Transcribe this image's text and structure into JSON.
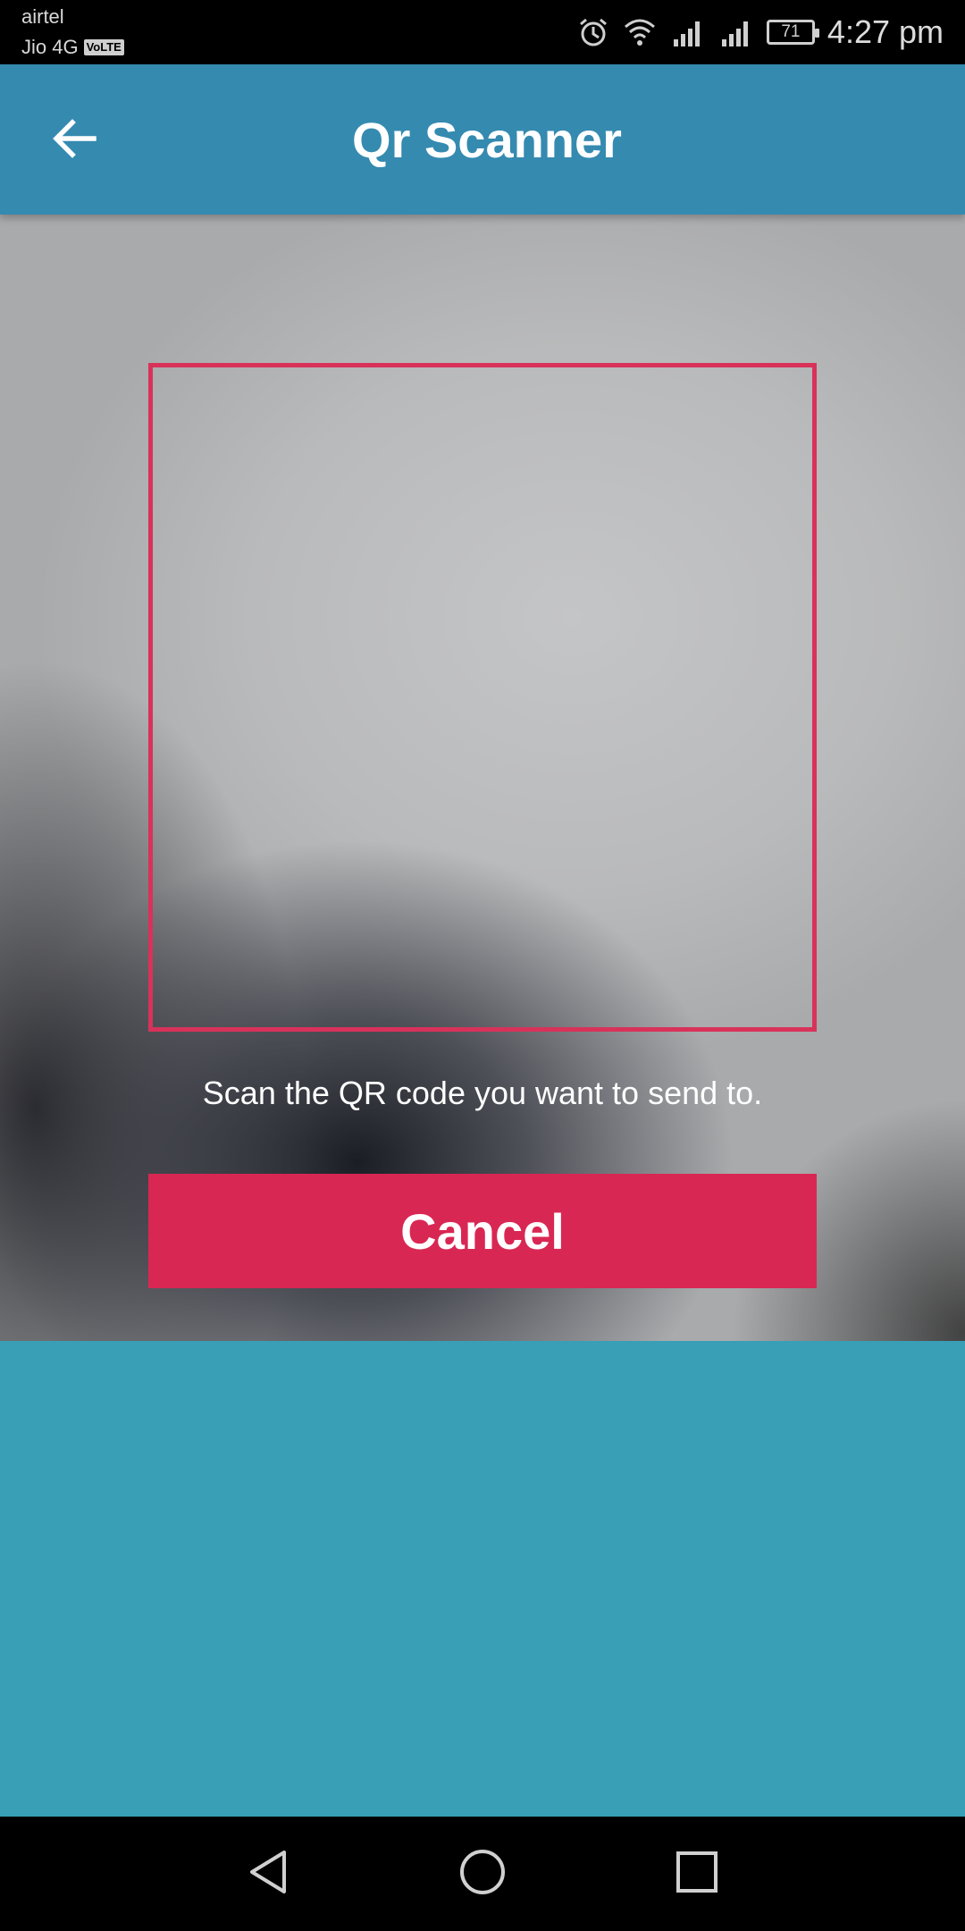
{
  "status_bar": {
    "carrier_primary": "airtel",
    "carrier_secondary": "Jio 4G",
    "volte_badge": "VoLTE",
    "battery_level": "71",
    "time": "4:27 pm",
    "icons": [
      "alarm-icon",
      "wifi-icon",
      "signal-icon",
      "signal-icon",
      "battery-icon"
    ]
  },
  "app_bar": {
    "title": "Qr Scanner",
    "back_icon": "arrow-left-icon"
  },
  "scanner": {
    "hint": "Scan the QR code you want to send to.",
    "cancel_label": "Cancel",
    "frame_color": "#d8325a",
    "button_color": "#d92753"
  },
  "colors": {
    "app_bar": "#358ab0",
    "bottom_area": "#389fb7"
  },
  "nav_bar": {
    "icons": [
      "nav-back-icon",
      "nav-home-icon",
      "nav-recent-icon"
    ]
  }
}
